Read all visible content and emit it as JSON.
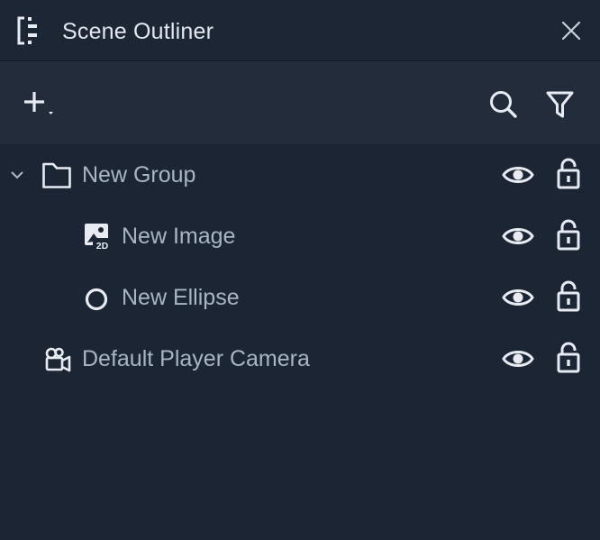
{
  "titlebar": {
    "title": "Scene Outliner",
    "icon": "outliner-icon",
    "close_icon": "close-icon"
  },
  "toolbar": {
    "add_icon": "add-icon",
    "search_icon": "search-icon",
    "filter_icon": "filter-icon"
  },
  "tree": {
    "items": [
      {
        "label": "New Group",
        "icon": "folder-icon",
        "expanded": true
      },
      {
        "label": "New Image",
        "icon": "image-2d-icon"
      },
      {
        "label": "New Ellipse",
        "icon": "ellipse-icon"
      },
      {
        "label": "Default Player Camera",
        "icon": "camera-icon"
      }
    ],
    "visibility_icon": "eye-icon",
    "lock_icon": "lock-icon"
  },
  "colors": {
    "background": "#1c2534",
    "toolbar": "#222c3b",
    "title_text": "#e3e7ee",
    "row_text": "#a9b4c4",
    "icon": "#e8ecf2"
  }
}
